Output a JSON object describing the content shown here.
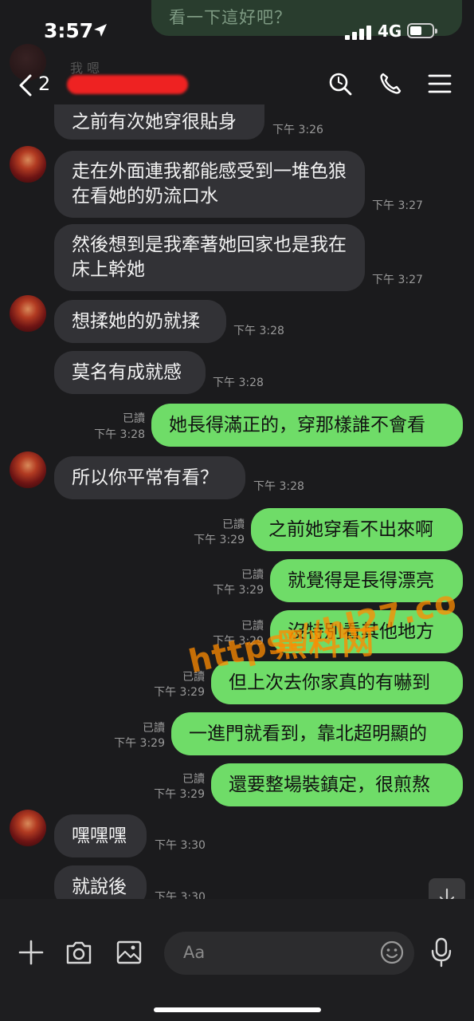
{
  "status_bar": {
    "time": "3:57",
    "network": "4G"
  },
  "header": {
    "back_count": "2"
  },
  "top_partial": {
    "text": "看一下這好吧？",
    "name": "我 嗯"
  },
  "messages": [
    {
      "side": "in",
      "text": "之前有次她穿很貼身",
      "time": "下午 3:26"
    },
    {
      "side": "in",
      "text": "走在外面連我都能感受到一堆色狼在看她的奶流口水",
      "time": "下午 3:27"
    },
    {
      "side": "in",
      "text": "然後想到是我牽著她回家也是我在床上幹她",
      "time": "下午 3:27"
    },
    {
      "side": "in",
      "text": "想揉她的奶就揉",
      "time": "下午 3:28"
    },
    {
      "side": "in",
      "text": "莫名有成就感",
      "time": "下午 3:28"
    },
    {
      "side": "out",
      "text": "她長得滿正的，穿那樣誰不會看",
      "read": "已讀",
      "time": "下午 3:28"
    },
    {
      "side": "in",
      "text": "所以你平常有看？",
      "time": "下午 3:28"
    },
    {
      "side": "out",
      "text": "之前她穿看不出來啊",
      "read": "已讀",
      "time": "下午 3:29"
    },
    {
      "side": "out",
      "text": "就覺得是長得漂亮",
      "read": "已讀",
      "time": "下午 3:29"
    },
    {
      "side": "out",
      "text": "沒特別看其他地方",
      "read": "已讀",
      "time": "下午 3:29"
    },
    {
      "side": "out",
      "text": "但上次去你家真的有嚇到",
      "read": "已讀",
      "time": "下午 3:29"
    },
    {
      "side": "out",
      "text": "一進門就看到，靠北超明顯的",
      "read": "已讀",
      "time": "下午 3:29"
    },
    {
      "side": "out",
      "text": "還要整場裝鎮定，很煎熬",
      "read": "已讀",
      "time": "下午 3:29"
    },
    {
      "side": "in",
      "text": "嘿嘿嘿",
      "time": "下午 3:30"
    },
    {
      "side": "in",
      "text": "就說後",
      "time": "下午 3:30"
    }
  ],
  "watermark": {
    "line1": "黑料网",
    "line2": "https://hl27.co"
  },
  "input": {
    "placeholder": "Aa"
  },
  "colors": {
    "outgoing_bubble": "#6fdc68",
    "incoming_bubble": "#323236",
    "background": "#1b1b1d",
    "watermark": "#ff8c00"
  },
  "icons": [
    "location-arrow-icon",
    "signal-icon",
    "battery-icon",
    "back-chevron-icon",
    "search-icon",
    "phone-icon",
    "menu-icon",
    "plus-icon",
    "camera-icon",
    "image-icon",
    "emoji-icon",
    "microphone-icon",
    "arrow-down-icon"
  ]
}
